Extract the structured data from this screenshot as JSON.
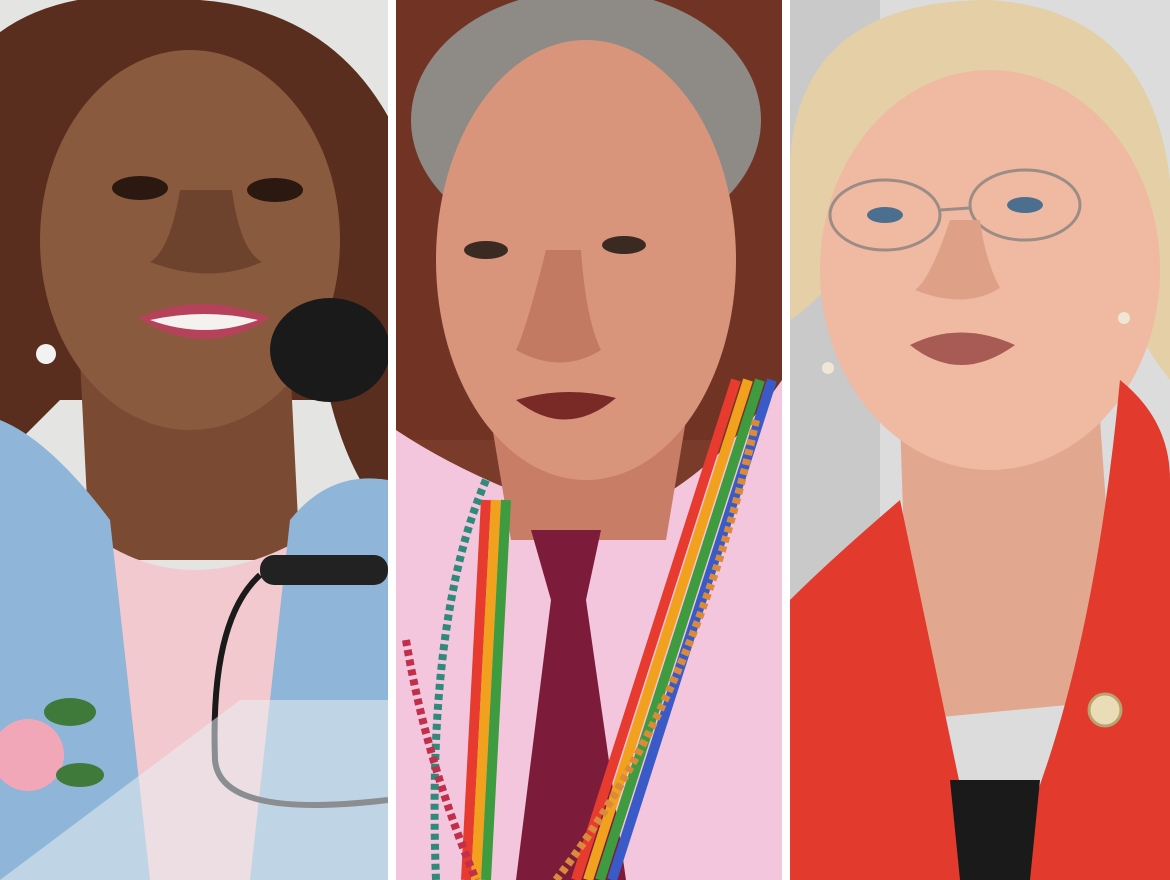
{
  "panels": [
    {
      "subject": "woman-speaking-at-microphone",
      "background": "#e4e4e2",
      "skin": "#8a5a3e",
      "hair": "#5a2e1e",
      "garment": "#8fb6d8",
      "shirt": "#f1c9cf"
    },
    {
      "subject": "man-with-rainbow-lanyard",
      "background": "#7a3b2a",
      "skin": "#d9957c",
      "hair": "#8e8a86",
      "garment": "#f3c6de",
      "tie": "#7d1c3a"
    },
    {
      "subject": "woman-in-red-jacket",
      "background": "#dcdcdc",
      "skin": "#efb9a2",
      "hair": "#e4cfa6",
      "garment": "#e23a2c"
    }
  ]
}
